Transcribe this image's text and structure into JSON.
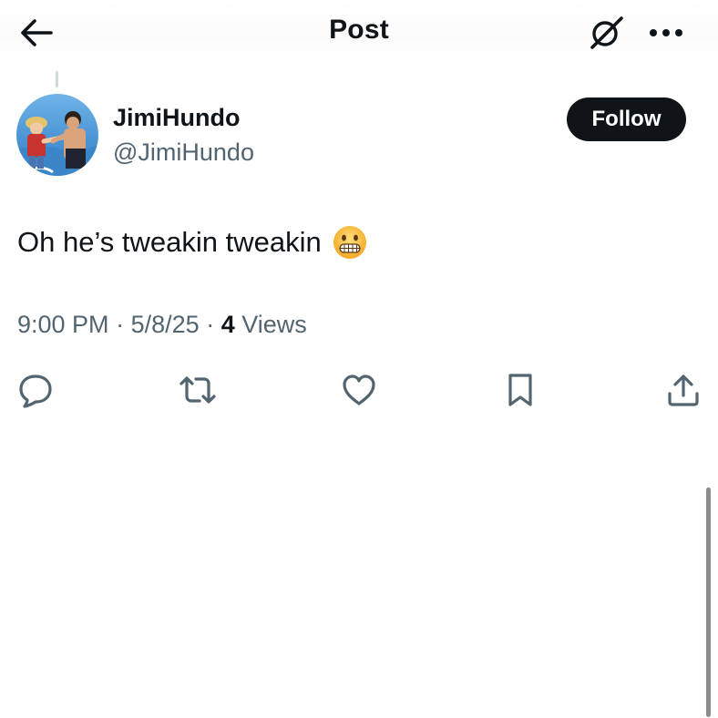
{
  "header": {
    "title": "Post",
    "back_icon": "arrow-left-icon",
    "grok_icon": "grok-icon",
    "more_icon": "more-horizontal-icon"
  },
  "author": {
    "display_name": "JimiHundo",
    "handle": "@JimiHundo",
    "follow_label": "Follow"
  },
  "post": {
    "text": "Oh he’s tweakin tweakin",
    "emoji": "grimacing-face-emoji",
    "time": "9:00 PM",
    "separator": "·",
    "date": "5/8/25",
    "views_count": "4",
    "views_label": "Views"
  },
  "actions": [
    {
      "name": "reply",
      "icon": "reply-icon"
    },
    {
      "name": "repost",
      "icon": "repost-icon"
    },
    {
      "name": "like",
      "icon": "heart-icon"
    },
    {
      "name": "bookmark",
      "icon": "bookmark-icon"
    },
    {
      "name": "share",
      "icon": "share-icon"
    }
  ],
  "colors": {
    "text": "#0f1419",
    "secondary": "#536471",
    "follow_bg": "#0f1419",
    "follow_text": "#ffffff"
  }
}
